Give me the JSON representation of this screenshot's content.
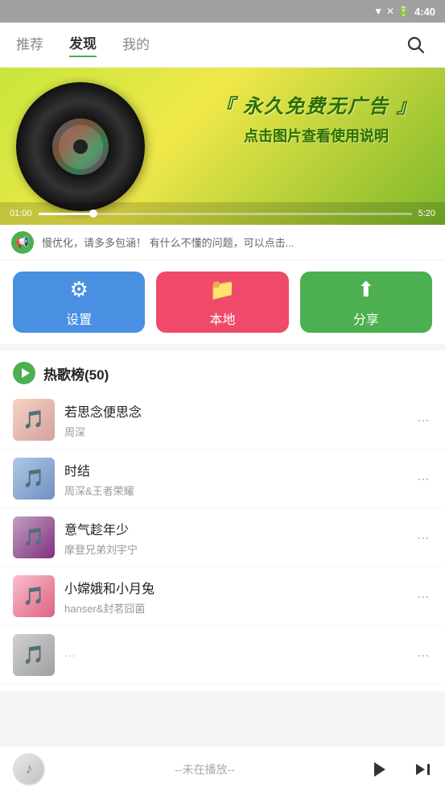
{
  "statusBar": {
    "time": "4:40"
  },
  "nav": {
    "tabs": [
      {
        "id": "tuijian",
        "label": "推荐",
        "active": false
      },
      {
        "id": "faxian",
        "label": "发现",
        "active": true
      },
      {
        "id": "wode",
        "label": "我的",
        "active": false
      }
    ],
    "searchLabel": "搜索"
  },
  "banner": {
    "title": "『 永久免费无广告 』",
    "subtitle": "点击图片查看使用说明",
    "timeStart": "01:00",
    "timeEnd": "5:20"
  },
  "announce": {
    "text": "慢优化，请多多包涵！  有什么不懂的问题，可以点击..."
  },
  "actionButtons": [
    {
      "id": "settings",
      "label": "设置",
      "icon": "⚙",
      "color": "blue"
    },
    {
      "id": "local",
      "label": "本地",
      "icon": "📁",
      "color": "red"
    },
    {
      "id": "share",
      "label": "分享",
      "icon": "↗",
      "color": "green"
    }
  ],
  "hotSongs": {
    "title": "热歌榜",
    "count": "50",
    "songs": [
      {
        "id": 1,
        "name": "若思念便思念",
        "artist": "周深",
        "thumb": "1"
      },
      {
        "id": 2,
        "name": "时结",
        "artist": "周深&王者荣耀",
        "thumb": "2"
      },
      {
        "id": 3,
        "name": "意气趁年少",
        "artist": "摩登兄弟刘宇宁",
        "thumb": "3"
      },
      {
        "id": 4,
        "name": "小嫦娥和小月兔",
        "artist": "hanser&封茗囧菌",
        "thumb": "4"
      },
      {
        "id": 5,
        "name": "...",
        "artist": "",
        "thumb": "5"
      }
    ]
  },
  "player": {
    "status": "--未在播放--",
    "icon": "♪"
  }
}
